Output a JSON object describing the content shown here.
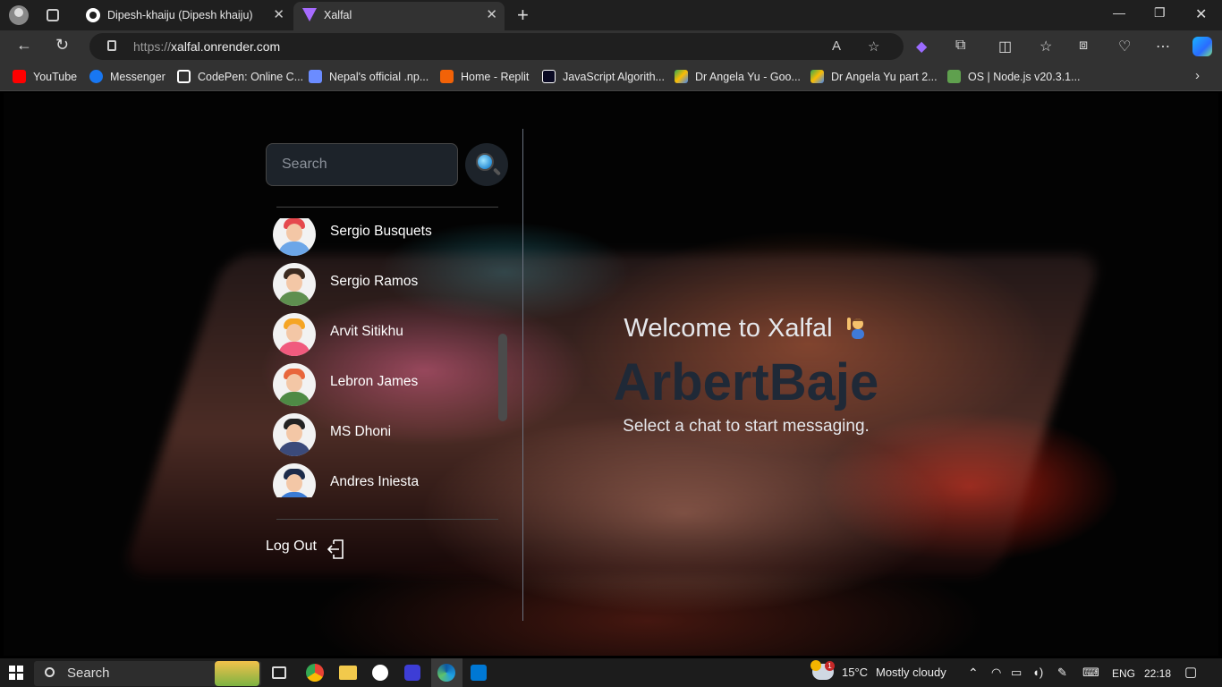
{
  "browser": {
    "tabs": [
      {
        "title": "Dipesh-khaiju (Dipesh khaiju)",
        "active": false,
        "favicon": "github-icon"
      },
      {
        "title": "Xalfal",
        "active": true,
        "favicon": "vite-icon"
      }
    ],
    "url_protocol": "https://",
    "url_host": "xalfal.onrender.com",
    "bookmarks": [
      {
        "label": "YouTube",
        "icon": "youtube-icon",
        "color": "#ff0000"
      },
      {
        "label": "Messenger",
        "icon": "facebook-icon",
        "color": "#1877f2"
      },
      {
        "label": "CodePen: Online C...",
        "icon": "codepen-icon",
        "color": "#ffffff"
      },
      {
        "label": "Nepal's official .np...",
        "icon": "np-icon",
        "color": "#6b8cff"
      },
      {
        "label": "Home - Replit",
        "icon": "replit-icon",
        "color": "#f26207"
      },
      {
        "label": "JavaScript Algorith...",
        "icon": "freecodecamp-icon",
        "color": "#0a0a23"
      },
      {
        "label": "Dr Angela Yu - Goo...",
        "icon": "drive-icon",
        "color": "#34a853"
      },
      {
        "label": "Dr Angela Yu part 2...",
        "icon": "drive-icon",
        "color": "#fbbc04"
      },
      {
        "label": "OS | Node.js v20.3.1...",
        "icon": "nodejs-icon",
        "color": "#5fa04e"
      }
    ]
  },
  "sidebar": {
    "search_placeholder": "Search",
    "conversations": [
      {
        "name": "Sergio Busquets",
        "hair": "#e5484d",
        "body": "#6ca6e8"
      },
      {
        "name": "Sergio Ramos",
        "hair": "#3b2a20",
        "body": "#5e8f4f"
      },
      {
        "name": "Arvit Sitikhu",
        "hair": "#f5a524",
        "body": "#f05a7e"
      },
      {
        "name": "Lebron James",
        "hair": "#e8663c",
        "body": "#4e8a45"
      },
      {
        "name": "MS Dhoni",
        "hair": "#222222",
        "body": "#3b4a7a"
      },
      {
        "name": "Andres Iniesta",
        "hair": "#1c2b4a",
        "body": "#3a7bd5"
      }
    ],
    "logout_label": "Log Out"
  },
  "welcome": {
    "greeting": "Welcome to Xalfal",
    "username": "ArbertBaje",
    "prompt": "Select a chat to start messaging."
  },
  "taskbar": {
    "search_label": "Search",
    "temperature": "15°C",
    "weather": "Mostly cloudy",
    "weather_badge": "1",
    "language": "ENG",
    "time": "22:18"
  }
}
